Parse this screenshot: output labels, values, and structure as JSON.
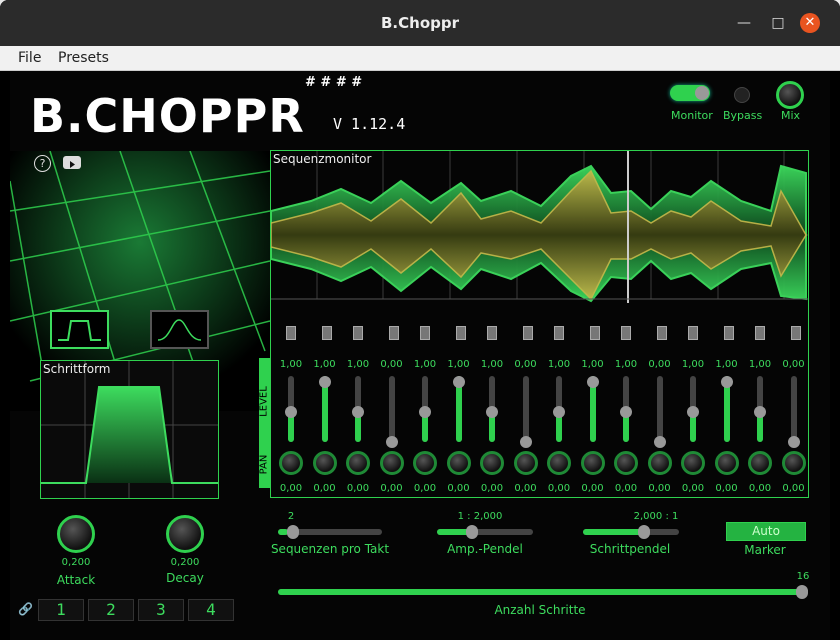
{
  "window": {
    "title": "B.Choppr"
  },
  "menu": [
    "File",
    "Presets"
  ],
  "header": {
    "logo": "B.CHOPPR",
    "version": "V 1.12.4",
    "hashes": "# # # #"
  },
  "toplabels": {
    "monitor": "Monitor",
    "bypass": "Bypass",
    "mix": "Mix"
  },
  "monitor_title": "Sequenzmonitor",
  "schrittform_title": "Schrittform",
  "side_labels": {
    "level": "LEVEL",
    "pan": "PAN"
  },
  "steps": {
    "levels": [
      "1,00",
      "1,00",
      "1,00",
      "0,00",
      "1,00",
      "1,00",
      "1,00",
      "0,00",
      "1,00",
      "1,00",
      "1,00",
      "0,00",
      "1,00",
      "1,00",
      "1,00",
      "0,00"
    ],
    "level_fractions": [
      0.5,
      1.0,
      0.5,
      0.0,
      0.5,
      1.0,
      0.5,
      0.0,
      0.5,
      1.0,
      0.5,
      0.0,
      0.5,
      1.0,
      0.5,
      0.0
    ],
    "pans": [
      "0,00",
      "0,00",
      "0,00",
      "0,00",
      "0,00",
      "0,00",
      "0,00",
      "0,00",
      "0,00",
      "0,00",
      "0,00",
      "0,00",
      "0,00",
      "0,00",
      "0,00",
      "0,00"
    ]
  },
  "attack": {
    "value": "0,200",
    "label": "Attack"
  },
  "decay": {
    "value": "0,200",
    "label": "Decay"
  },
  "presets": [
    "1",
    "2",
    "3",
    "4"
  ],
  "sliders": {
    "sequences": {
      "value": "2",
      "label": "Sequenzen pro Takt",
      "fraction": 0.1
    },
    "amp": {
      "value": "1 : 2,000",
      "label": "Amp.-Pendel",
      "fraction": 0.35
    },
    "step": {
      "value": "2,000 : 1",
      "label": "Schrittpendel",
      "fraction": 0.65
    },
    "marker": {
      "button": "Auto",
      "label": "Marker"
    },
    "count": {
      "value": "16",
      "label": "Anzahl Schritte",
      "fraction": 1.0
    }
  }
}
